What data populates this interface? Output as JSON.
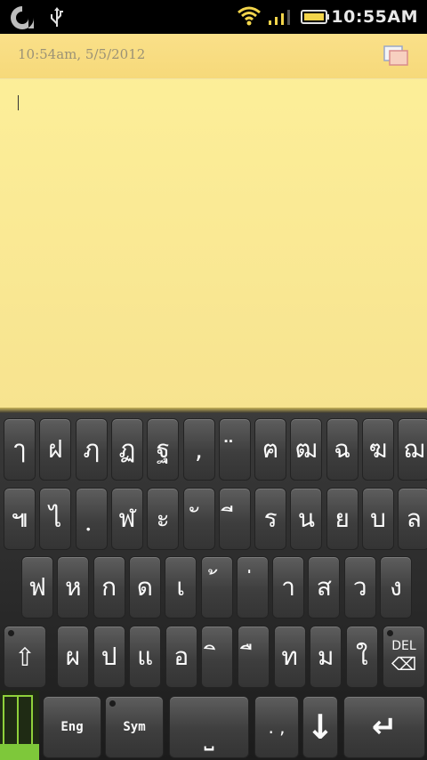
{
  "status_bar": {
    "time": "10:55AM",
    "icons": [
      "app-logo-icon",
      "usb-icon",
      "wifi-icon",
      "signal-icon",
      "battery-icon"
    ]
  },
  "note": {
    "timestamp": "10:54am, 5/5/2012",
    "body_text": "",
    "colors": {
      "paper": "#fdf09a",
      "header": "#f6d97a"
    }
  },
  "keyboard": {
    "row1": [
      "ๅ",
      "ฝ",
      "ฦ",
      "ฏ",
      "ฐ",
      ",",
      "̈",
      "ฅ",
      "ฒ",
      "ฉ",
      "ฆ",
      "ฌ"
    ],
    "row2": [
      "๚",
      "ไ",
      "ฺ",
      "ฬ",
      "ะ",
      "ั",
      "ี",
      "ร",
      "น",
      "ย",
      "บ",
      "ล"
    ],
    "row3": [
      "ฟ",
      "ห",
      "ก",
      "ด",
      "เ",
      "้",
      "่",
      "า",
      "ส",
      "ว",
      "ง"
    ],
    "row4": [
      "ผ",
      "ป",
      "แ",
      "อ",
      "ิ",
      "ื",
      "ท",
      "ม",
      "ใ"
    ],
    "shift_label": "⇧",
    "del_label": "DEL",
    "eng_label": "Eng",
    "sym_label": "Sym",
    "space_label": "⎵",
    "punct_label": ". ,",
    "down_label": "↓",
    "enter_label": "↵"
  }
}
